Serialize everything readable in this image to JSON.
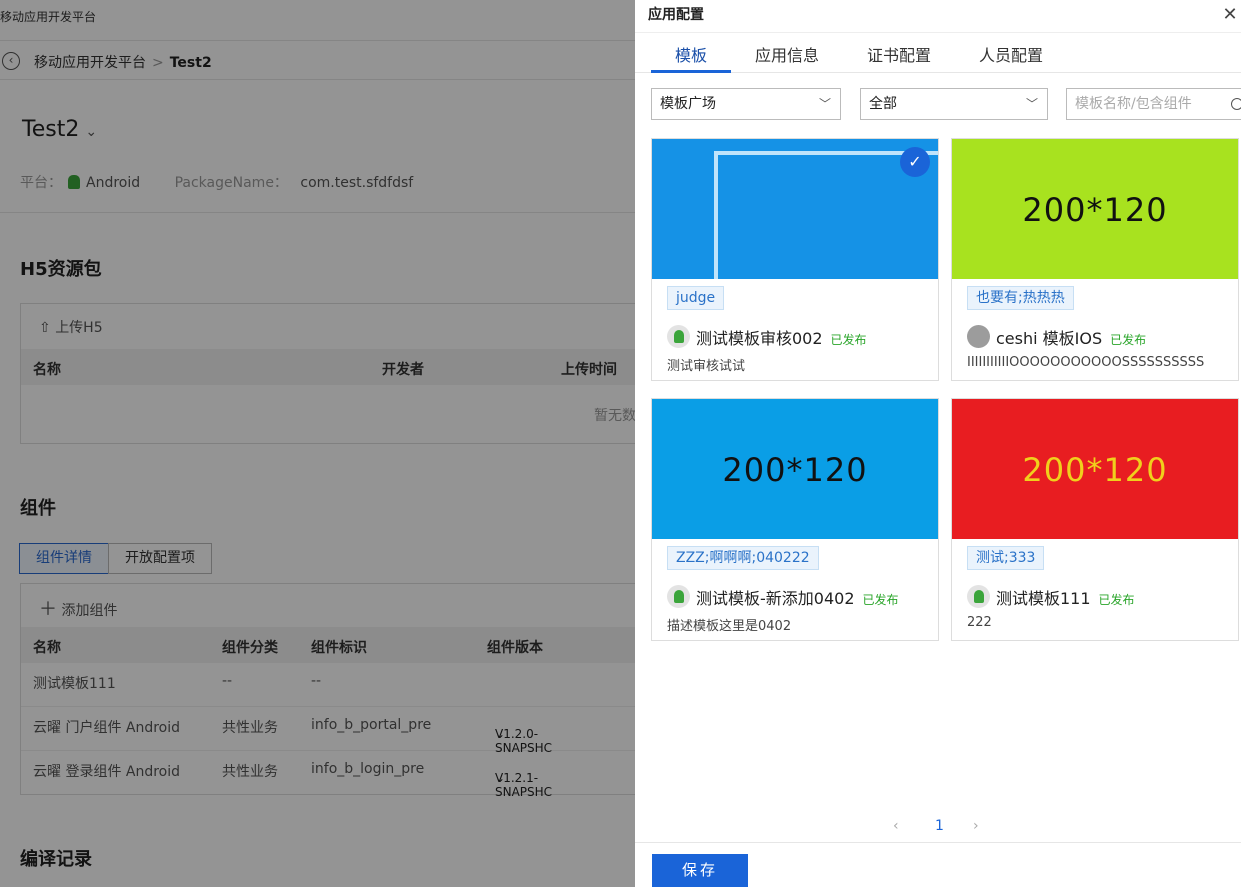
{
  "app_title": "移动应用开发平台",
  "breadcrumb": {
    "root": "移动应用开发平台",
    "sep": ">",
    "current": "Test2"
  },
  "project": {
    "name": "Test2",
    "platform_label": "平台：",
    "platform_value": "Android",
    "package_label": "PackageName：",
    "package_value": "com.test.sfdfdsf"
  },
  "h5": {
    "title": "H5资源包",
    "upload_label": "上传H5",
    "columns": [
      "名称",
      "开发者",
      "上传时间"
    ],
    "empty_text": "暂无数"
  },
  "components": {
    "title": "组件",
    "tabs": [
      "组件详情",
      "开放配置项"
    ],
    "add_label": "添加组件",
    "columns": [
      "名称",
      "组件分类",
      "组件标识",
      "组件版本"
    ],
    "rows": [
      {
        "name": "测试模板111",
        "category": "--",
        "id": "--",
        "version": ""
      },
      {
        "name": "云曜 门户组件 Android",
        "category": "共性业务",
        "id": "info_b_portal_pre",
        "version": "V1.2.0-SNAPSHC"
      },
      {
        "name": "云曜 登录组件 Android",
        "category": "共性业务",
        "id": "info_b_login_pre",
        "version": "V1.2.1-SNAPSHC"
      }
    ]
  },
  "compile": {
    "title": "编译记录"
  },
  "drawer": {
    "title": "应用配置",
    "tabs": [
      "模板",
      "应用信息",
      "证书配置",
      "人员配置"
    ],
    "filter1": "模板广场",
    "filter2": "全部",
    "search_placeholder": "模板名称/包含组件",
    "cards": [
      {
        "thumb_text": "",
        "thumb_color": "#1592e6",
        "tag": "judge",
        "platform": "android",
        "name": "测试模板审核002",
        "status": "已发布",
        "desc": "测试审核试试",
        "selected": true
      },
      {
        "thumb_text": "200*120",
        "thumb_color": "#a8e21f",
        "tag": "也要有;热热热",
        "platform": "ios",
        "name": "ceshi 模板IOS",
        "status": "已发布",
        "desc": "IIIIIIIIIIIOOOOOOOOOOOSSSSSSSSSS",
        "selected": false
      },
      {
        "thumb_text": "200*120",
        "thumb_color": "#0a9ee6",
        "tag": "ZZZ;啊啊啊;040222",
        "platform": "android",
        "name": "测试模板-新添加0402",
        "status": "已发布",
        "desc": "描述模板这里是0402",
        "selected": false
      },
      {
        "thumb_text": "200*120",
        "thumb_color": "#e81d21",
        "tag": "测试;333",
        "platform": "android",
        "name": "测试模板111",
        "status": "已发布",
        "desc": "222",
        "selected": false
      }
    ],
    "page": "1",
    "save_label": "保存"
  }
}
